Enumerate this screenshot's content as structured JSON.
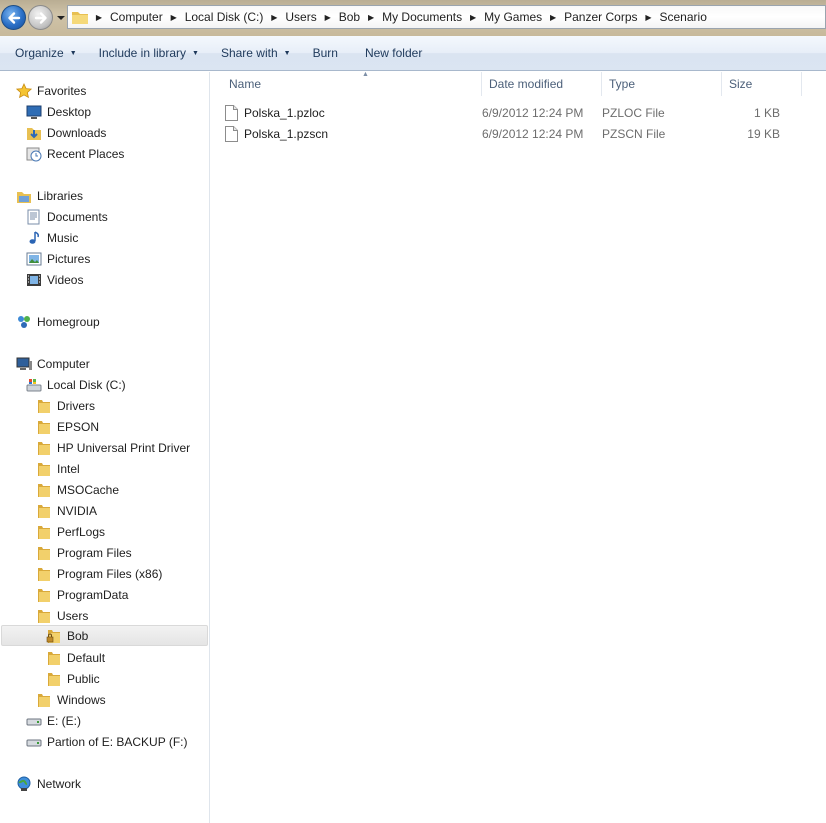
{
  "address": {
    "crumbs": [
      "Computer",
      "Local Disk (C:)",
      "Users",
      "Bob",
      "My Documents",
      "My Games",
      "Panzer Corps",
      "Scenario"
    ]
  },
  "toolbar": {
    "organize": "Organize",
    "include_in_library": "Include in library",
    "share_with": "Share with",
    "burn": "Burn",
    "new_folder": "New folder"
  },
  "nav": {
    "favorites": "Favorites",
    "desktop": "Desktop",
    "downloads": "Downloads",
    "recent_places": "Recent Places",
    "libraries": "Libraries",
    "documents": "Documents",
    "music": "Music",
    "pictures": "Pictures",
    "videos": "Videos",
    "homegroup": "Homegroup",
    "computer": "Computer",
    "local_disk": "Local Disk (C:)",
    "folders": [
      "Drivers",
      "EPSON",
      "HP Universal Print Driver",
      "Intel",
      "MSOCache",
      "NVIDIA",
      "PerfLogs",
      "Program Files",
      "Program Files (x86)",
      "ProgramData",
      "Users"
    ],
    "users_children": [
      "Bob",
      "Default",
      "Public"
    ],
    "windows": "Windows",
    "drive_e": "E: (E:)",
    "drive_f": "Partion of E: BACKUP (F:)",
    "network": "Network"
  },
  "columns": {
    "name": "Name",
    "date_modified": "Date modified",
    "type": "Type",
    "size": "Size"
  },
  "files": [
    {
      "name": "Polska_1.pzloc",
      "date": "6/9/2012 12:24 PM",
      "type": "PZLOC File",
      "size": "1 KB"
    },
    {
      "name": "Polska_1.pzscn",
      "date": "6/9/2012 12:24 PM",
      "type": "PZSCN File",
      "size": "19 KB"
    }
  ],
  "colors": {
    "toolbar_text": "#1e395b",
    "column_header_text": "#4c607a",
    "folder": "#e8c052"
  }
}
